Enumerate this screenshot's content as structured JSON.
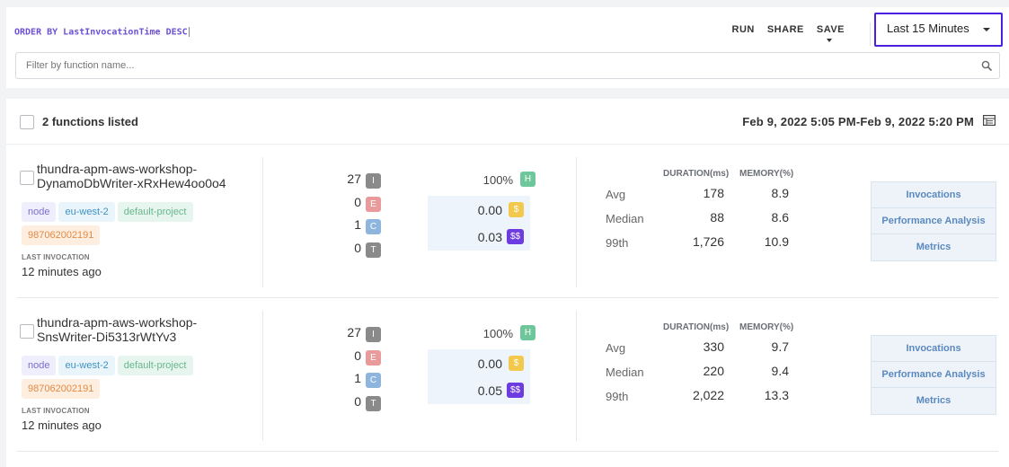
{
  "query": {
    "text": "ORDER BY LastInvocationTime DESC"
  },
  "toolbar": {
    "run": "RUN",
    "share": "SHARE",
    "save": "SAVE"
  },
  "time_range": {
    "selected": "Last 15 Minutes"
  },
  "filter": {
    "placeholder": "Filter by function name..."
  },
  "list": {
    "count_label": "2 functions listed",
    "date_range": "Feb 9, 2022 5:05 PM-Feb 9, 2022 5:20 PM"
  },
  "columns": {
    "duration": "DURATION(ms)",
    "memory": "MEMORY(%)"
  },
  "badges": {
    "I": "I",
    "E": "E",
    "C": "C",
    "T": "T",
    "H": "H",
    "D": "$",
    "DD": "$$"
  },
  "links": {
    "invocations": "Invocations",
    "performance": "Performance Analysis",
    "metrics": "Metrics"
  },
  "functions": [
    {
      "name_line1": "thundra-apm-aws-workshop-",
      "name_line2": "DynamoDbWriter-xRxHew4oo0o4",
      "tags": {
        "runtime": "node",
        "region": "eu-west-2",
        "project": "default-project",
        "account": "987062002191"
      },
      "last_invocation_label": "LAST INVOCATION",
      "last_invocation": "12 minutes ago",
      "counts": {
        "invocations": "27",
        "errors": "0",
        "cold_starts": "1",
        "timeouts": "0"
      },
      "health": "100%",
      "cost": "0.00",
      "cost_estimated": "0.03",
      "stats": {
        "avg": {
          "label": "Avg",
          "duration": "178",
          "memory": "8.9"
        },
        "median": {
          "label": "Median",
          "duration": "88",
          "memory": "8.6"
        },
        "p99": {
          "label": "99th",
          "duration": "1,726",
          "memory": "10.9"
        }
      }
    },
    {
      "name_line1": "thundra-apm-aws-workshop-",
      "name_line2": "SnsWriter-Di5313rWtYv3",
      "tags": {
        "runtime": "node",
        "region": "eu-west-2",
        "project": "default-project",
        "account": "987062002191"
      },
      "last_invocation_label": "LAST INVOCATION",
      "last_invocation": "12 minutes ago",
      "counts": {
        "invocations": "27",
        "errors": "0",
        "cold_starts": "1",
        "timeouts": "0"
      },
      "health": "100%",
      "cost": "0.00",
      "cost_estimated": "0.05",
      "stats": {
        "avg": {
          "label": "Avg",
          "duration": "330",
          "memory": "9.7"
        },
        "median": {
          "label": "Median",
          "duration": "220",
          "memory": "9.4"
        },
        "p99": {
          "label": "99th",
          "duration": "2,022",
          "memory": "13.3"
        }
      }
    }
  ]
}
